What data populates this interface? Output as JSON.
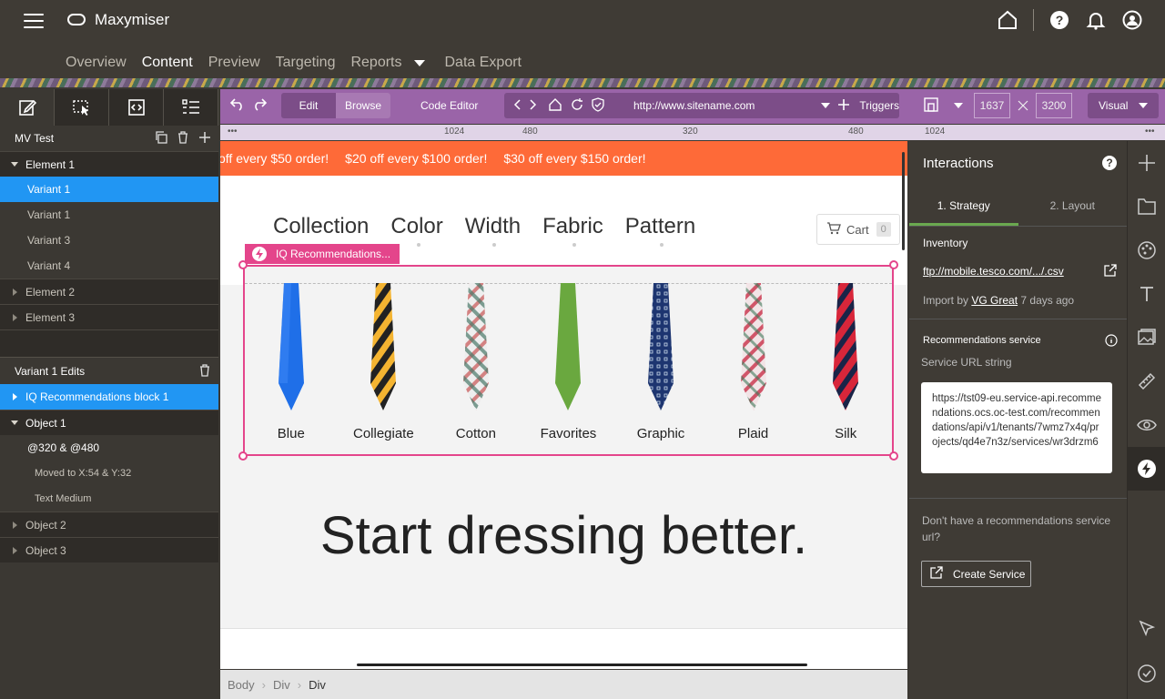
{
  "header": {
    "app_name": "Maxymiser",
    "nav": [
      "Overview",
      "Content",
      "Preview",
      "Targeting",
      "Reports",
      "Data Export"
    ],
    "active_nav": "Content"
  },
  "left_panel": {
    "test_title": "MV Test",
    "elements": [
      {
        "label": "Element 1",
        "expanded": true,
        "variants": [
          "Variant 1",
          "Variant 1",
          "Variant 3",
          "Variant 4"
        ]
      },
      {
        "label": "Element 2"
      },
      {
        "label": "Element 3"
      }
    ],
    "edits_title": "Variant 1 Edits",
    "edits": {
      "block": "IQ Recommendations block 1",
      "object1": "Object 1",
      "breakpoint": "@320 & @480",
      "moved": "Moved to X:54 & Y:32",
      "text": "Text Medium",
      "object2": "Object 2",
      "object3": "Object 3"
    }
  },
  "toolbar": {
    "edit": "Edit",
    "browse": "Browse",
    "code_editor": "Code Editor",
    "url": "http://www.sitename.com",
    "triggers": "Triggers",
    "width": "1637",
    "height": "3200",
    "mode": "Visual"
  },
  "ruler": {
    "marks": [
      "1024",
      "480",
      "320",
      "480",
      "1024"
    ],
    "dots": "•••"
  },
  "site": {
    "promo": [
      "off every $50 order!",
      "$20 off every $100 order!",
      "$30 off every $150 order!"
    ],
    "categories": [
      "Collection",
      "Color",
      "Width",
      "Fabric",
      "Pattern"
    ],
    "cart_label": "Cart",
    "cart_count": "0",
    "iq_label": "IQ Recommendations...",
    "ties": [
      "Blue",
      "Collegiate",
      "Cotton",
      "Favorites",
      "Graphic",
      "Plaid",
      "Silk"
    ],
    "headline": "Start dressing better."
  },
  "breadcrumb": [
    "Body",
    "Div",
    "Div"
  ],
  "right_panel": {
    "title": "Interactions",
    "tabs": [
      "1. Strategy",
      "2. Layout"
    ],
    "inventory_label": "Inventory",
    "inventory_link": "ftp://mobile.tesco.com/.../.csv",
    "import_prefix": "Import by",
    "import_user": "VG Great",
    "import_when": "7 days ago",
    "service_title": "Recommendations service",
    "service_url_label": "Service URL string",
    "service_url": "https://tst09-eu.service-api.recommendations.ocs.oc-test.com/recommendations/api/v1/tenants/7wmz7x4q/projects/qd4e7n3z/services/wr3drzm6",
    "no_service": "Don't have a recommendations service url?",
    "create_service": "Create Service"
  },
  "colors": {
    "accent": "#9a64a8",
    "selection": "#2196f3",
    "promo": "#fe6a38",
    "highlight": "#e4458b"
  }
}
